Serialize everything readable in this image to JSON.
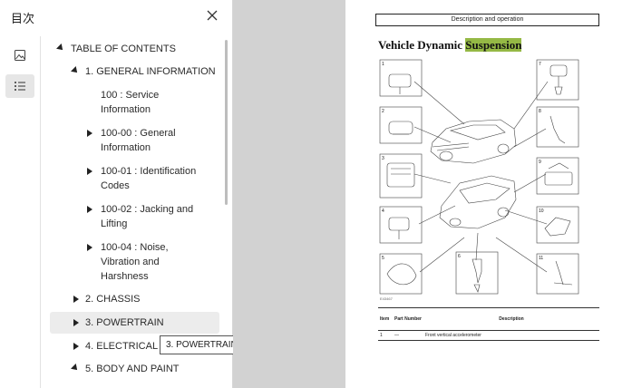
{
  "panel": {
    "title": "目次",
    "toc": [
      {
        "label": "TABLE OF CONTENTS",
        "expander": "expanded"
      },
      {
        "label": "1. GENERAL INFORMATION",
        "expander": "expanded"
      },
      {
        "label1": "100 : Service",
        "label2": "Information",
        "expander": "none"
      },
      {
        "label1": "100-00 : General",
        "label2": "Information",
        "expander": "collapsed"
      },
      {
        "label1": "100-01 : Identification",
        "label2": "Codes",
        "expander": "collapsed"
      },
      {
        "label1": "100-02 : Jacking and",
        "label2": "Lifting",
        "expander": "collapsed"
      },
      {
        "label1": "100-04 : Noise,",
        "label2": "Vibration and",
        "label3": "Harshness",
        "expander": "collapsed"
      },
      {
        "label": "2. CHASSIS",
        "expander": "collapsed"
      },
      {
        "label": "3. POWERTRAIN",
        "expander": "collapsed"
      },
      {
        "label": "4. ELECTRICAL",
        "expander": "collapsed"
      },
      {
        "label": "5. BODY AND PAINT",
        "expander": "expanded"
      }
    ],
    "tooltip": "3. POWERTRAIN"
  },
  "icons": {
    "close": "close-icon",
    "thumbnails": "image-thumbnails-icon",
    "outline": "list-outline-icon"
  },
  "document": {
    "header": "Description and operation",
    "title_prefix": "Vehicle Dynamic ",
    "title_highlight": "Suspension",
    "highlight_color": "#95b945",
    "figure_id": "E43467",
    "callouts": [
      "1",
      "2",
      "3",
      "4",
      "5",
      "6",
      "7",
      "8",
      "9",
      "10",
      "11"
    ],
    "table": {
      "headers": [
        "Item",
        "Part Number",
        "Description"
      ],
      "rows": [
        [
          "1",
          "—",
          "Front vertical accelerometer"
        ]
      ]
    }
  }
}
